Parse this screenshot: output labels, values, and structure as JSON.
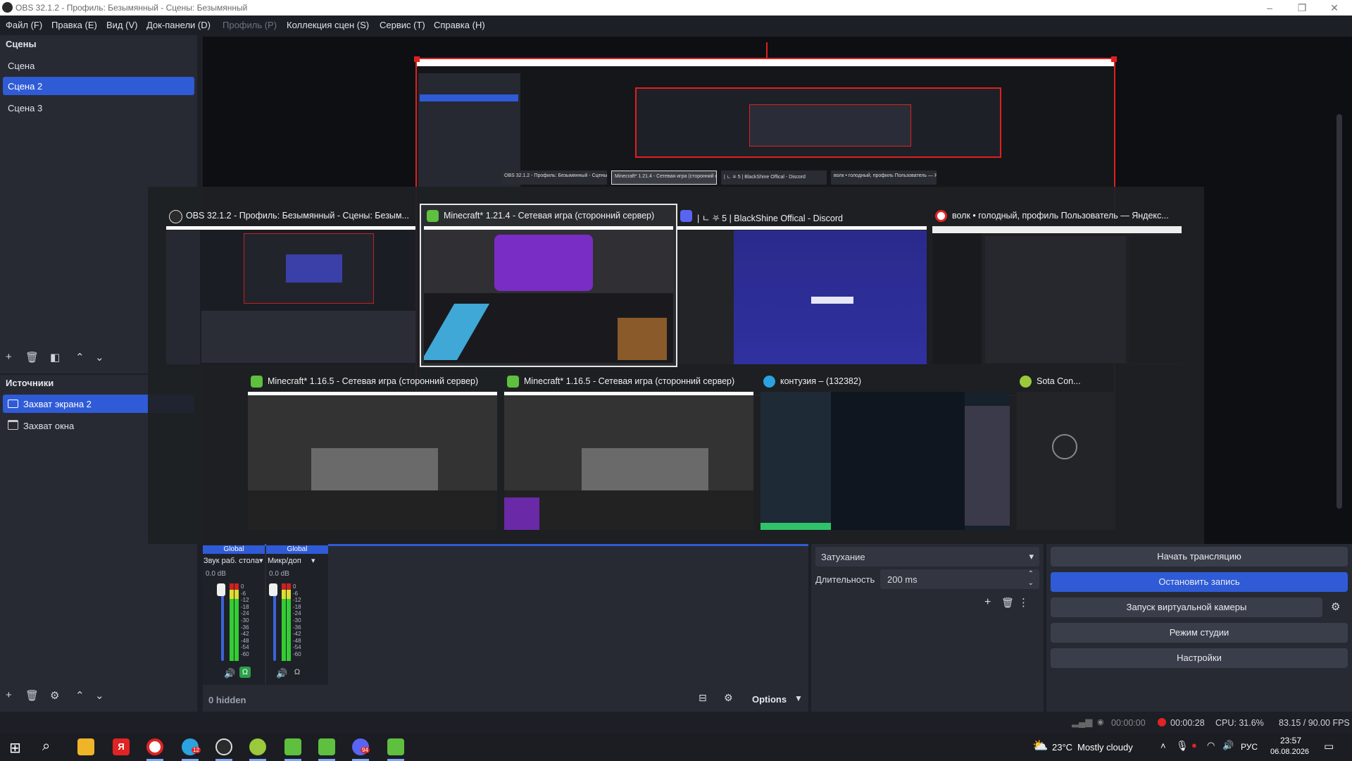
{
  "window": {
    "title": "OBS 32.1.2 - Профиль: Безымянный - Сцены: Безымянный"
  },
  "menu": [
    "Файл (F)",
    "Правка (E)",
    "Вид (V)",
    "Док-панели (D)",
    "Профиль (P)",
    "Коллекция сцен (S)",
    "Сервис (T)",
    "Справка (H)"
  ],
  "scenes": {
    "title": "Сцены",
    "items": [
      "Сцена",
      "Сцена 2",
      "Сцена 3"
    ],
    "selected": "Сцена 2"
  },
  "sources": {
    "title": "Источники",
    "items": [
      "Захват экрана 2",
      "Захват окна"
    ],
    "selected": "Захват экрана 2"
  },
  "switcher": {
    "windows": [
      {
        "title": "OBS 32.1.2 - Профиль: Безымянный - Сцены: Безым...",
        "icon": "obs-icon",
        "active": false
      },
      {
        "title": "Minecraft* 1.21.4 - Сетевая игра (сторонний сервер)",
        "icon": "minecraft-icon",
        "active": true
      },
      {
        "title": "| ㄴ ⛧ 5 | BlackShine Offical - Discord",
        "icon": "discord-icon",
        "active": false
      },
      {
        "title": "волк • голодный, профиль Пользователь — Яндекс...",
        "icon": "yandex-browser-icon",
        "active": false
      },
      {
        "title": "Minecraft* 1.16.5 - Сетевая игра (сторонний сервер)",
        "icon": "minecraft-icon",
        "active": false
      },
      {
        "title": "Minecraft* 1.16.5 - Сетевая игра (сторонний сервер)",
        "icon": "minecraft-icon",
        "active": false
      },
      {
        "title": "контузия – (132382)",
        "icon": "telegram-icon",
        "active": false
      },
      {
        "title": "Sota Con...",
        "icon": "sota-icon",
        "active": false
      }
    ],
    "mini_thumbs": [
      "OBS 32.1.2 - Профиль: Безымянный - Сцены: Безым...",
      "Minecraft* 1.21.4 - Сетевая игра (сторонний сервер)",
      "| ㄴ ⛧ 5 | BlackShine Offical - Discord",
      "волк • голодный, профиль Пользователь — Яндекс..."
    ]
  },
  "mixer": {
    "channels": [
      {
        "tag": "Global",
        "name": "Звук раб. стола",
        "db": "0.0 dB"
      },
      {
        "tag": "Global",
        "name": "Микр/доп",
        "db": "0.0 dB"
      }
    ],
    "scale": [
      "0",
      "-6",
      "-12",
      "-18",
      "-24",
      "-30",
      "-36",
      "-42",
      "-48",
      "-54",
      "-60"
    ],
    "hidden": "0 hidden",
    "options": "Options"
  },
  "transitions": {
    "type": "Затухание",
    "duration_label": "Длительность",
    "duration_value": "200 ms"
  },
  "controls": {
    "start_stream": "Начать трансляцию",
    "stop_record": "Остановить запись",
    "virtual_cam": "Запуск виртуальной камеры",
    "studio_mode": "Режим студии",
    "settings": "Настройки"
  },
  "status": {
    "stream_time": "00:00:00",
    "record_time": "00:00:28",
    "cpu": "CPU: 31.6%",
    "fps": "83.15 / 90.00 FPS"
  },
  "taskbar": {
    "weather_temp": "23°C",
    "weather_text": "Mostly cloudy",
    "lang": "РУС",
    "time": "23:57",
    "date": "06.08.2026",
    "telegram_badge": "12",
    "discord_badge": "94"
  },
  "colors": {
    "accent": "#2f5bd6",
    "panel": "#272a33",
    "background": "#1d1f26",
    "record_red": "#e02424",
    "meter_green": "#3cc43c"
  }
}
